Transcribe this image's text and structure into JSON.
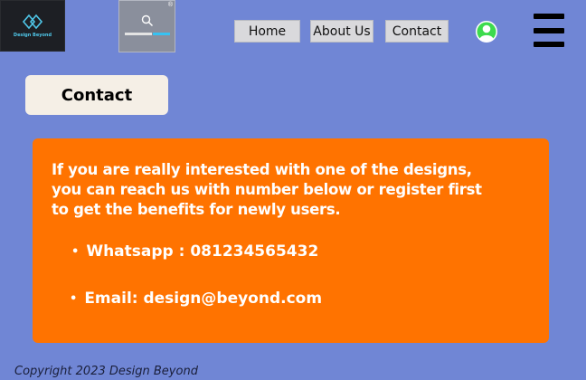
{
  "logo": {
    "text": "Design Beyond"
  },
  "search": {
    "badge": "®"
  },
  "nav": {
    "home": "Home",
    "about": "About Us",
    "contact": "Contact"
  },
  "page": {
    "title": "Contact"
  },
  "info": {
    "intro": "If you are really interested with one of the designs, you can reach us with number below or register first to get the benefits for newly users.",
    "whatsapp": "Whatsapp : 081234565432",
    "email": "Email: design@beyond.com",
    "bullet": "•"
  },
  "footer": {
    "copyright": "Copyright 2023 Design Beyond"
  },
  "colors": {
    "background": "#7086d5",
    "card": "#ff7300",
    "avatar": "#3ddb4d",
    "accent": "#36c2f2"
  },
  "icons": [
    "logo-diamond-icon",
    "search-icon",
    "user-avatar-icon",
    "hamburger-menu-icon"
  ]
}
